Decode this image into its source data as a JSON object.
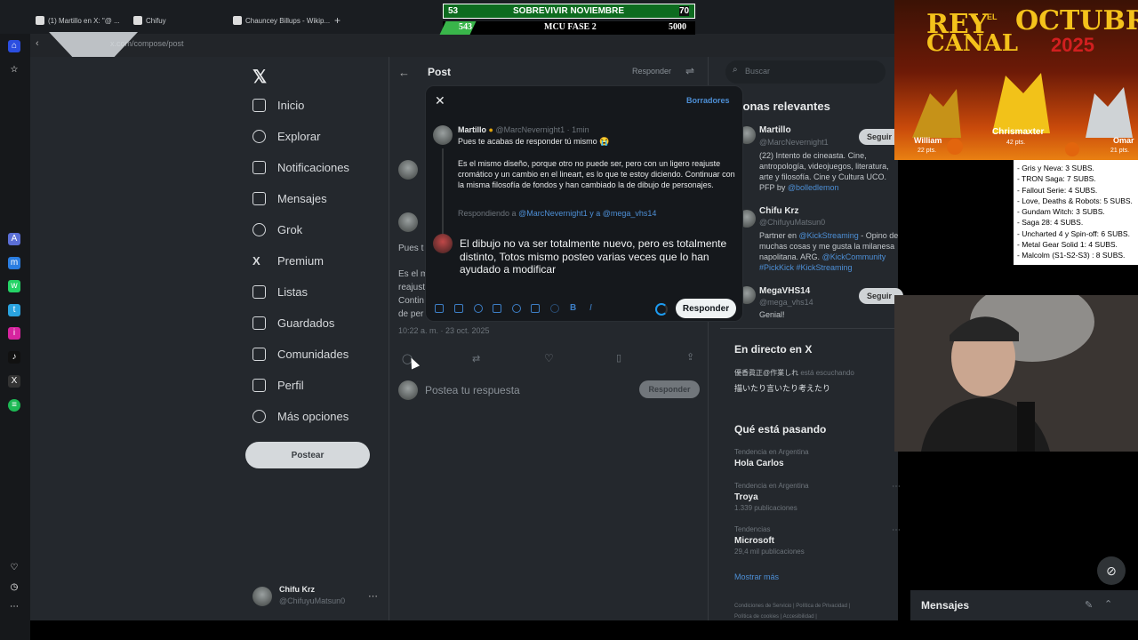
{
  "browser": {
    "tabs": [
      "(1) Martillo en X: \"@ ...",
      "Chifuy",
      "Chauncey Billups - Wikip..."
    ],
    "url": "x.com/compose/post"
  },
  "overlays": {
    "banner_row1": {
      "left": "53",
      "title": "SOBREVIVIR NOVIEMBRE",
      "right": "70"
    },
    "banner_row2": {
      "left": "543",
      "title": "MCU FASE 2",
      "right": "5000"
    },
    "rey_title_left": "REY",
    "rey_title_el": "EL",
    "rey_title_canal": "CANAL",
    "rey_month": "OCTUBRE",
    "rey_year": "2025",
    "rey_winner": "Chrismaxter",
    "rey_winner_pts": "42 pts.",
    "rey_left": "William",
    "rey_left_pts": "22 pts.",
    "rey_right": "Omar",
    "rey_right_pts": "21 pts.",
    "subs": [
      "- Gris y Neva: 3 SUBS.",
      "- TRON Saga: 7 SUBS.",
      "- Fallout Serie: 4 SUBS.",
      "- Love, Deaths & Robots: 5 SUBS.",
      "- Gundam Witch: 3 SUBS.",
      "- Saga 28: 4 SUBS.",
      "- Uncharted 4 y Spin-off: 6 SUBS.",
      "- Metal Gear Solid 1: 4 SUBS.",
      "- Malcolm (S1-S2-S3) : 8 SUBS."
    ]
  },
  "nav": {
    "items": [
      "Inicio",
      "Explorar",
      "Notificaciones",
      "Mensajes",
      "Grok",
      "Premium",
      "Listas",
      "Guardados",
      "Comunidades",
      "Perfil",
      "Más opciones"
    ],
    "post_button": "Postear",
    "account_name": "Chifu Krz",
    "account_handle": "@ChifuyuMatsun0"
  },
  "mid": {
    "header_title": "Post",
    "header_reply": "Responder",
    "partial_text": [
      "Pues t",
      "Es el m",
      "reajust",
      "Contin",
      "de per"
    ],
    "timestamp": "10:22 a. m. · 23 oct. 2025",
    "reply_placeholder": "Postea tu respuesta",
    "reply_button": "Responder"
  },
  "modal": {
    "drafts": "Borradores",
    "author_name": "Martillo",
    "author_handle": "@MarcNevernight1 · 1min",
    "line1": "Pues te acabas de responder tú mismo 😭",
    "body": "Es el mismo diseño, porque otro no puede ser, pero con un ligero reajuste cromático y un cambio en el lineart, es lo que te estoy diciendo. Continuar con la misma filosofía de fondos y han cambiado la de dibujo de personajes.",
    "replying_label": "Respondiendo a",
    "replying_users": "@MarcNevernight1 y a @mega_vhs14",
    "draft_text": "El dibujo no va ser totalmente nuevo, pero es totalmente distinto, Totos mismo posteo varias veces que lo han ayudado a modificar",
    "reply_button": "Responder"
  },
  "right": {
    "search_placeholder": "Buscar",
    "relevant_title": "ersonas relevantes",
    "people": [
      {
        "name": "Martillo",
        "handle": "@MarcNevernight1",
        "bio": "(22) Intento de cineasta. Cine, antropología, videojuegos, literatura, arte y filosofía. Cine y Cultura UCO. PFP by",
        "bio_link": "@bolledlemon",
        "follow": "Seguir"
      },
      {
        "name": "Chifu Krz",
        "handle": "@ChifuyuMatsun0",
        "bio": "Partner en",
        "bio_link": "@KickStreaming",
        "bio2": " - Opino de muchas cosas y me gusta la milanesa napolitana. ARG.",
        "bio_link2": "@KickCommunity #PickKick #KickStreaming"
      },
      {
        "name": "MegaVHS14",
        "handle": "@mega_vhs14",
        "bio": "Genial!",
        "follow": "Seguir"
      }
    ],
    "live_title": "En directo en X",
    "live_user": "優香眞正@作業しれ",
    "live_status": "está escuchando",
    "live_text": "描いたり言いたり考えたり",
    "trends_title": "Qué está pasando",
    "trends": [
      {
        "context": "Tendencia en Argentina",
        "name": "Hola Carlos",
        "count": ""
      },
      {
        "context": "Tendencia en Argentina",
        "name": "Troya",
        "count": "1.339 publicaciones"
      },
      {
        "context": "Tendencias",
        "name": "Microsoft",
        "count": "29,4 mil publicaciones"
      }
    ],
    "show_more": "Mostrar más",
    "footer": [
      "Condiciones de Servicio",
      "Política de Privacidad",
      "Política de cookies",
      "Accesibilidad"
    ],
    "messages": "Mensajes"
  },
  "colors": {
    "accent": "#1d9bf0",
    "background": "#24282d",
    "modal": "#15181c"
  }
}
